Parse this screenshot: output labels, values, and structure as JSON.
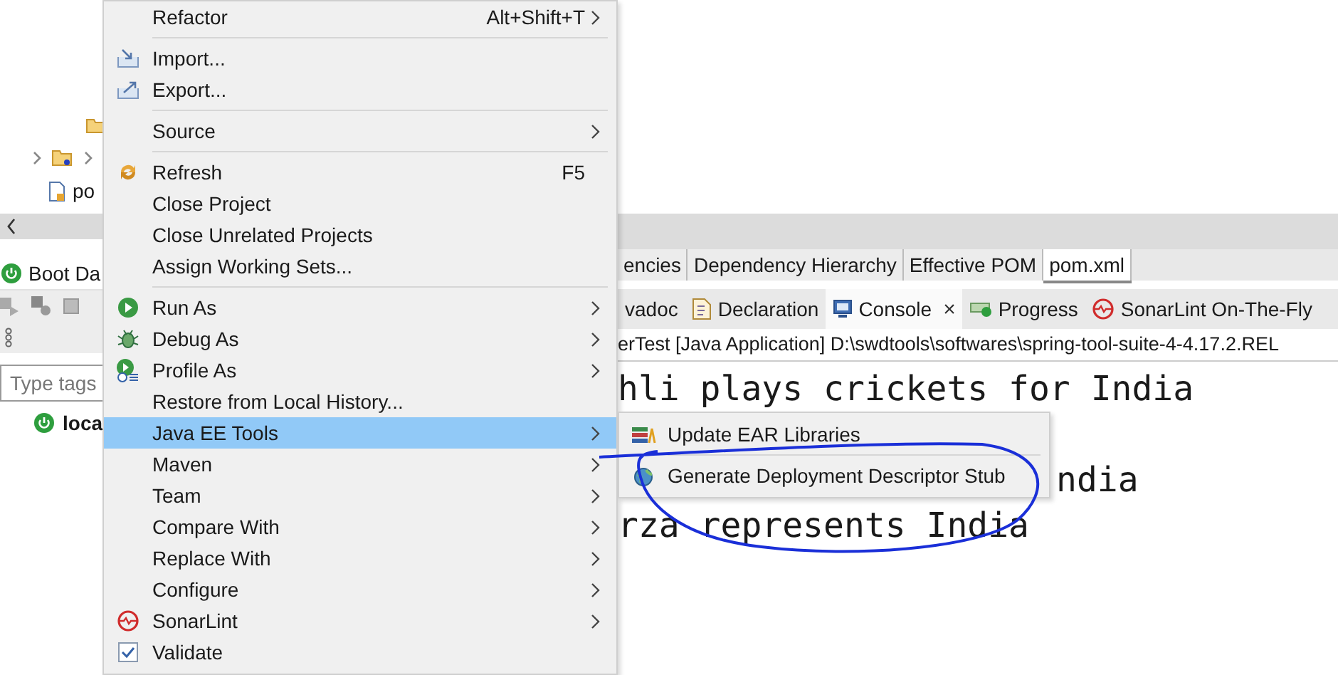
{
  "project_explorer": {
    "file_label": "po"
  },
  "boot_dashboard": {
    "tab_label": "Boot Da",
    "tags_field": {
      "placeholder": "Type tags"
    },
    "items": [
      {
        "label": "loca"
      }
    ]
  },
  "editor": {
    "tabs": [
      {
        "label": "encies",
        "selected": false
      },
      {
        "label": "Dependency Hierarchy",
        "selected": false
      },
      {
        "label": "Effective POM",
        "selected": false
      },
      {
        "label": "pom.xml",
        "selected": true
      }
    ]
  },
  "views": {
    "tabs": [
      {
        "label": "vadoc",
        "selected": false,
        "closable": false
      },
      {
        "label": "Declaration",
        "selected": false,
        "closable": false
      },
      {
        "label": "Console",
        "selected": true,
        "closable": true,
        "close_glyph": "×"
      },
      {
        "label": "Progress",
        "selected": false,
        "closable": false
      },
      {
        "label": "SonarLint On-The-Fly",
        "selected": false,
        "closable": false
      }
    ]
  },
  "console": {
    "header": "erTest [Java Application] D:\\swdtools\\softwares\\spring-tool-suite-4-4.17.2.REL",
    "lines": [
      "hli plays crickets for India",
      "ndia",
      "rza represents India"
    ]
  },
  "context_menu": {
    "items": [
      {
        "kind": "item",
        "label": "Refactor",
        "shortcut": "Alt+Shift+T",
        "submenu": true,
        "selected": false
      },
      {
        "kind": "separator"
      },
      {
        "kind": "item",
        "label": "Import...",
        "submenu": false,
        "selected": false
      },
      {
        "kind": "item",
        "label": "Export...",
        "submenu": false,
        "selected": false
      },
      {
        "kind": "separator"
      },
      {
        "kind": "item",
        "label": "Source",
        "submenu": true,
        "selected": false
      },
      {
        "kind": "separator"
      },
      {
        "kind": "item",
        "label": "Refresh",
        "shortcut": "F5",
        "submenu": false,
        "selected": false
      },
      {
        "kind": "item",
        "label": "Close Project",
        "submenu": false,
        "selected": false
      },
      {
        "kind": "item",
        "label": "Close Unrelated Projects",
        "submenu": false,
        "selected": false
      },
      {
        "kind": "item",
        "label": "Assign Working Sets...",
        "submenu": false,
        "selected": false
      },
      {
        "kind": "separator"
      },
      {
        "kind": "item",
        "label": "Run As",
        "submenu": true,
        "selected": false
      },
      {
        "kind": "item",
        "label": "Debug As",
        "submenu": true,
        "selected": false
      },
      {
        "kind": "item",
        "label": "Profile As",
        "submenu": true,
        "selected": false
      },
      {
        "kind": "item",
        "label": "Restore from Local History...",
        "submenu": false,
        "selected": false
      },
      {
        "kind": "item",
        "label": "Java EE Tools",
        "submenu": true,
        "selected": true
      },
      {
        "kind": "item",
        "label": "Maven",
        "submenu": true,
        "selected": false
      },
      {
        "kind": "item",
        "label": "Team",
        "submenu": true,
        "selected": false
      },
      {
        "kind": "item",
        "label": "Compare With",
        "submenu": true,
        "selected": false
      },
      {
        "kind": "item",
        "label": "Replace With",
        "submenu": true,
        "selected": false
      },
      {
        "kind": "item",
        "label": "Configure",
        "submenu": true,
        "selected": false
      },
      {
        "kind": "item",
        "label": "SonarLint",
        "submenu": true,
        "selected": false
      },
      {
        "kind": "item",
        "label": "Validate",
        "submenu": false,
        "selected": false
      }
    ]
  },
  "submenu": {
    "items": [
      {
        "kind": "item",
        "label": "Update EAR Libraries"
      },
      {
        "kind": "separator"
      },
      {
        "kind": "item",
        "label": "Generate Deployment Descriptor Stub"
      }
    ]
  }
}
